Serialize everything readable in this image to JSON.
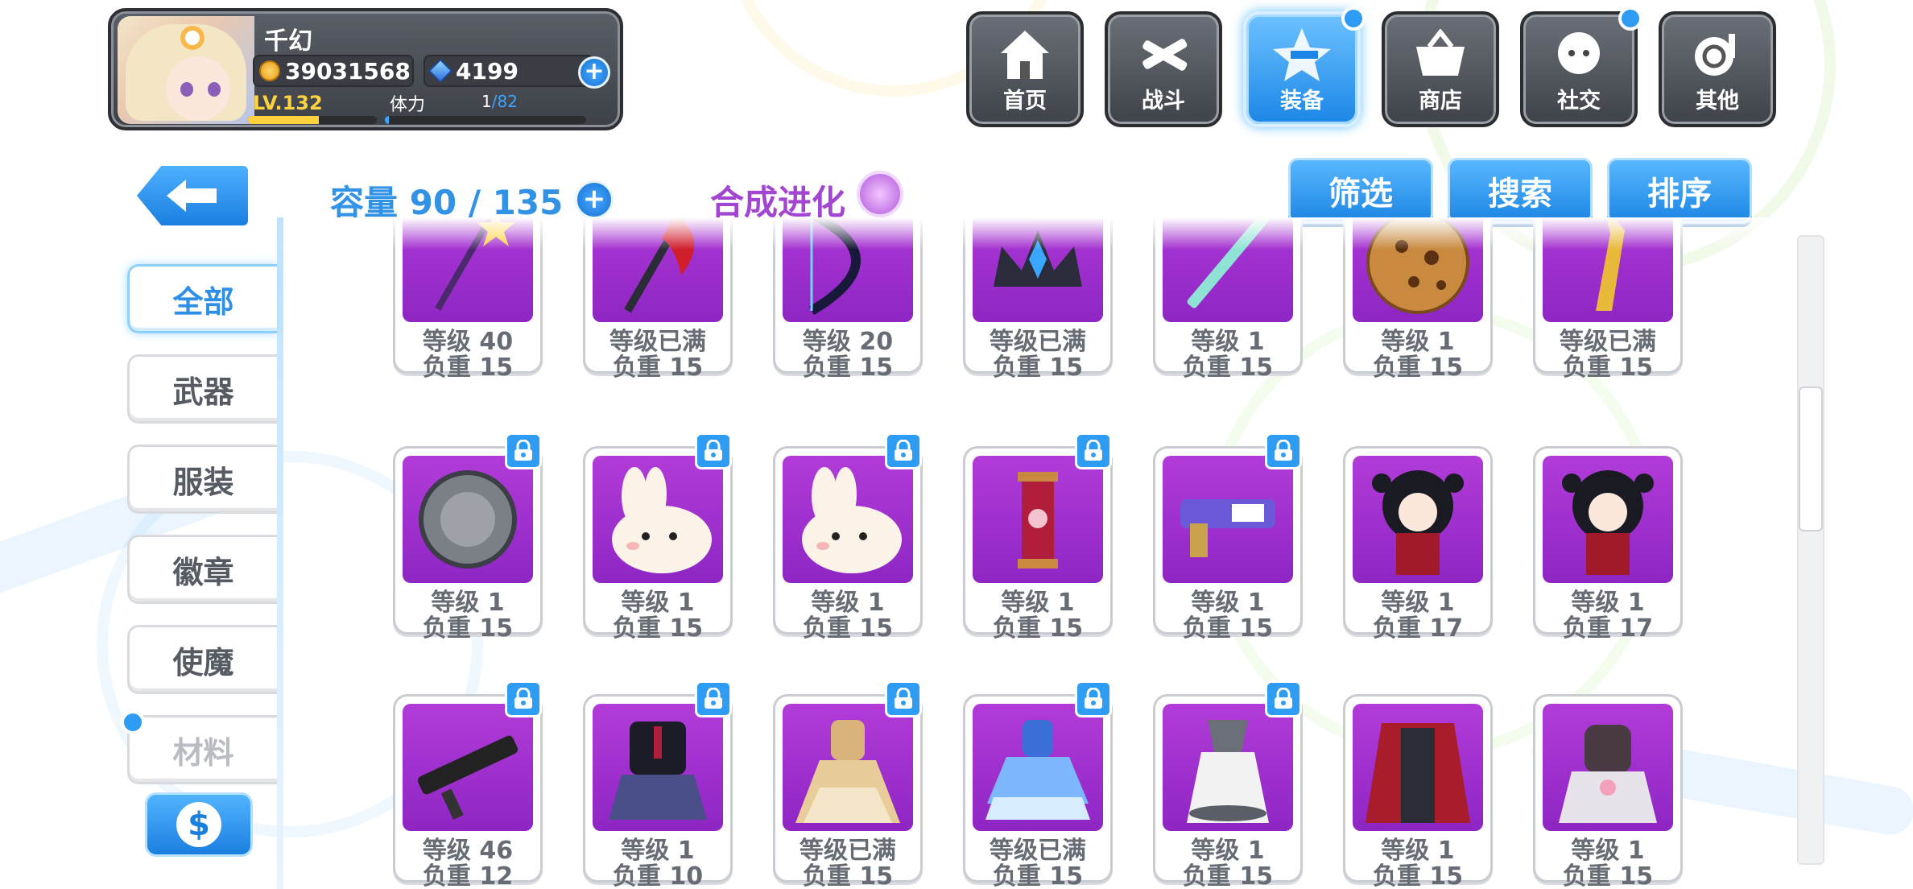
{
  "player": {
    "name": "千幻",
    "gold": "39031568",
    "gems": "4199",
    "level": "LV.132",
    "stamina_label": "体力",
    "stamina_current": "1",
    "stamina_max": "/82",
    "level_progress": 0.55,
    "stamina_progress": 0.02
  },
  "nav": [
    {
      "label": "首页",
      "icon": "home-icon",
      "active": false,
      "dot": false
    },
    {
      "label": "战斗",
      "icon": "battle-swords-icon",
      "active": false,
      "dot": false
    },
    {
      "label": "装备",
      "icon": "equipment-star-gun-icon",
      "active": true,
      "dot": true
    },
    {
      "label": "商店",
      "icon": "shop-basket-icon",
      "active": false,
      "dot": false
    },
    {
      "label": "社交",
      "icon": "social-face-icon",
      "active": false,
      "dot": true
    },
    {
      "label": "其他",
      "icon": "other-snail-icon",
      "active": false,
      "dot": false
    }
  ],
  "toolbar": {
    "capacity": "容量 90 / 135",
    "evolve": "合成进化",
    "filter": "筛选",
    "search": "搜索",
    "sort": "排序"
  },
  "categories": [
    {
      "label": "全部",
      "state": "active"
    },
    {
      "label": "武器",
      "state": "normal"
    },
    {
      "label": "服装",
      "state": "normal"
    },
    {
      "label": "徽章",
      "state": "normal"
    },
    {
      "label": "使魔",
      "state": "normal"
    },
    {
      "label": "材料",
      "state": "dim"
    }
  ],
  "items": [
    [
      {
        "icon": "star-staff-icon",
        "level": "等级 40",
        "weight": "负重 15",
        "locked": false
      },
      {
        "icon": "red-axe-icon",
        "level": "等级已满",
        "weight": "负重 15",
        "locked": false
      },
      {
        "icon": "dark-bow-icon",
        "level": "等级 20",
        "weight": "负重 15",
        "locked": false
      },
      {
        "icon": "crystal-crown-icon",
        "level": "等级已满",
        "weight": "负重 15",
        "locked": false
      },
      {
        "icon": "jade-sword-icon",
        "level": "等级 1",
        "weight": "负重 15",
        "locked": false
      },
      {
        "icon": "cookie-icon",
        "level": "等级 1",
        "weight": "负重 15",
        "locked": false
      },
      {
        "icon": "golden-blade-icon",
        "level": "等级已满",
        "weight": "负重 15",
        "locked": false
      }
    ],
    [
      {
        "icon": "steel-shield-icon",
        "level": "等级 1",
        "weight": "负重 15",
        "locked": true
      },
      {
        "icon": "bunny-icon",
        "level": "等级 1",
        "weight": "负重 15",
        "locked": true
      },
      {
        "icon": "bunny-icon",
        "level": "等级 1",
        "weight": "负重 15",
        "locked": true
      },
      {
        "icon": "red-lantern-icon",
        "level": "等级 1",
        "weight": "负重 15",
        "locked": true
      },
      {
        "icon": "mail-gun-icon",
        "level": "等级 1",
        "weight": "负重 15",
        "locked": true
      },
      {
        "icon": "kimono-doll-icon",
        "level": "等级 1",
        "weight": "负重 17",
        "locked": false
      },
      {
        "icon": "kimono-doll-icon",
        "level": "等级 1",
        "weight": "负重 17",
        "locked": false
      }
    ],
    [
      {
        "icon": "black-rifle-icon",
        "level": "等级 46",
        "weight": "负重 12",
        "locked": true
      },
      {
        "icon": "school-uniform-icon",
        "level": "等级 1",
        "weight": "负重 10",
        "locked": true
      },
      {
        "icon": "golden-dress-icon",
        "level": "等级已满",
        "weight": "负重 15",
        "locked": true
      },
      {
        "icon": "blue-frill-dress-icon",
        "level": "等级已满",
        "weight": "负重 15",
        "locked": true
      },
      {
        "icon": "white-dress-icon",
        "level": "等级 1",
        "weight": "负重 15",
        "locked": true
      },
      {
        "icon": "red-cape-outfit-icon",
        "level": "等级 1",
        "weight": "负重 15",
        "locked": false
      },
      {
        "icon": "fur-coat-outfit-icon",
        "level": "等级 1",
        "weight": "负重 15",
        "locked": false
      }
    ]
  ],
  "colors": {
    "accent": "#2e9cf2",
    "purple_tile": "#a230d4",
    "evolve": "#a246d2",
    "level_bar": "#ffd23f",
    "stamina_bar": "#3aa6ff"
  }
}
